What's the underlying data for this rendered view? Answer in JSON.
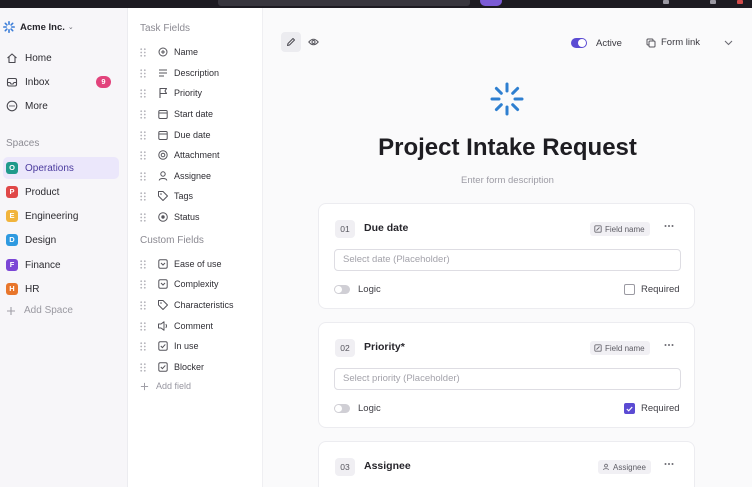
{
  "workspace": {
    "name": "Acme Inc.",
    "caret": "⌄"
  },
  "nav": [
    {
      "label": "Home",
      "icon": "home-icon"
    },
    {
      "label": "Inbox",
      "icon": "inbox-icon",
      "badge": "9"
    },
    {
      "label": "More",
      "icon": "more-circle-icon"
    }
  ],
  "spaces": {
    "heading": "Spaces",
    "items": [
      {
        "letter": "O",
        "label": "Operations",
        "color": "#1f9a8b",
        "active": true
      },
      {
        "letter": "P",
        "label": "Product",
        "color": "#e04848"
      },
      {
        "letter": "E",
        "label": "Engineering",
        "color": "#f1b43c"
      },
      {
        "letter": "D",
        "label": "Design",
        "color": "#2f9ae0"
      },
      {
        "letter": "F",
        "label": "Finance",
        "color": "#7b46d6"
      },
      {
        "letter": "H",
        "label": "HR",
        "color": "#e8762c"
      }
    ],
    "add_label": "Add Space"
  },
  "task_fields": {
    "heading": "Task Fields",
    "items": [
      {
        "label": "Name",
        "icon": "name-field-icon"
      },
      {
        "label": "Description",
        "icon": "description-icon"
      },
      {
        "label": "Priority",
        "icon": "flag-icon"
      },
      {
        "label": "Start date",
        "icon": "calendar-icon"
      },
      {
        "label": "Due date",
        "icon": "calendar-icon"
      },
      {
        "label": "Attachment",
        "icon": "paperclip-icon"
      },
      {
        "label": "Assignee",
        "icon": "person-icon"
      },
      {
        "label": "Tags",
        "icon": "tag-icon"
      },
      {
        "label": "Status",
        "icon": "status-icon"
      }
    ]
  },
  "custom_fields": {
    "heading": "Custom Fields",
    "items": [
      {
        "label": "Ease of use",
        "icon": "dropdown-icon"
      },
      {
        "label": "Complexity",
        "icon": "dropdown-icon"
      },
      {
        "label": "Characteristics",
        "icon": "tag-icon"
      },
      {
        "label": "Comment",
        "icon": "comment-icon"
      },
      {
        "label": "In use",
        "icon": "checkbox-icon"
      },
      {
        "label": "Blocker",
        "icon": "checkbox-icon"
      }
    ],
    "add_label": "Add field"
  },
  "toolbar": {
    "active_label": "Active",
    "active_on": true,
    "form_link_label": "Form link"
  },
  "form": {
    "title": "Project Intake Request",
    "description_placeholder": "Enter form description",
    "questions": [
      {
        "number": "01",
        "title": "Due date",
        "tag": "Field name",
        "tag_icon": "field-name-icon",
        "placeholder": "Select date (Placeholder)",
        "logic_label": "Logic",
        "required_label": "Required",
        "required": false
      },
      {
        "number": "02",
        "title": "Priority*",
        "tag": "Field name",
        "tag_icon": "field-name-icon",
        "placeholder": "Select priority (Placeholder)",
        "logic_label": "Logic",
        "required_label": "Required",
        "required": true
      },
      {
        "number": "03",
        "title": "Assignee",
        "tag": "Assignee",
        "tag_icon": "person-icon"
      }
    ]
  },
  "colors": {
    "accent": "#5b4bd3",
    "active_space_bg": "#ebe7fb",
    "badge": "#e2437c"
  }
}
